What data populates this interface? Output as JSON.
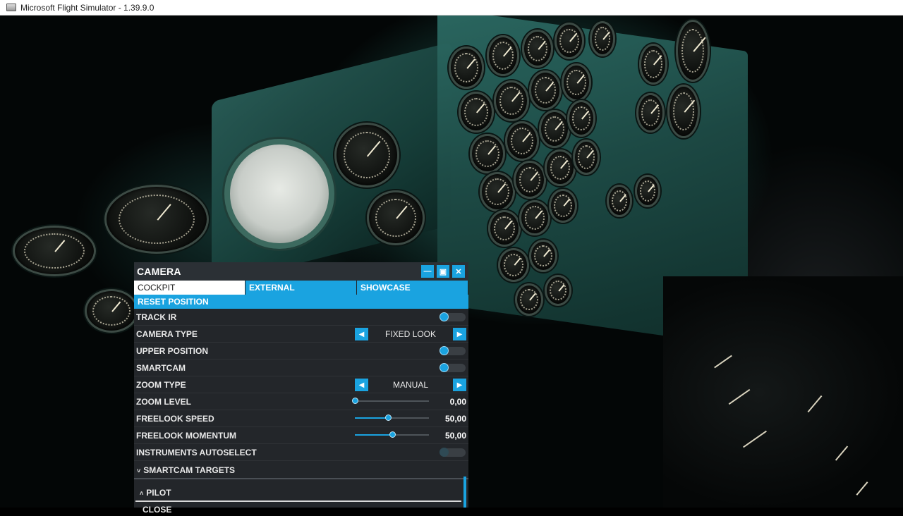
{
  "window": {
    "title": "Microsoft Flight Simulator - 1.39.9.0"
  },
  "camera_panel": {
    "title": "CAMERA",
    "header_buttons": [
      "minimize",
      "undock",
      "close"
    ],
    "tabs": [
      {
        "label": "COCKPIT",
        "active": true
      },
      {
        "label": "EXTERNAL",
        "active": false
      },
      {
        "label": "SHOWCASE",
        "active": false
      }
    ],
    "reset_label": "RESET POSITION",
    "settings": {
      "track_ir": {
        "label": "TRACK IR",
        "state": "on"
      },
      "camera_type": {
        "label": "CAMERA TYPE",
        "value": "FIXED LOOK"
      },
      "upper_position": {
        "label": "UPPER POSITION",
        "state": "on"
      },
      "smartcam": {
        "label": "SMARTCAM",
        "state": "on"
      },
      "zoom_type": {
        "label": "ZOOM TYPE",
        "value": "MANUAL"
      },
      "zoom_level": {
        "label": "ZOOM LEVEL",
        "value": "0,00",
        "fraction": 0.0
      },
      "freelook_speed": {
        "label": "FREELOOK SPEED",
        "value": "50,00",
        "fraction": 0.45
      },
      "freelook_momentum": {
        "label": "FREELOOK MOMENTUM",
        "value": "50,00",
        "fraction": 0.5
      },
      "instruments_autoselect": {
        "label": "INSTRUMENTS AUTOSELECT",
        "state": "off"
      }
    },
    "smartcam_targets": {
      "label": "SMARTCAM TARGETS",
      "pilot_label": "PILOT",
      "close_label": "CLOSE"
    }
  },
  "colors": {
    "accent": "#1aa3e0",
    "panel_bg": "#24282c",
    "title_bar_bg": "#ffffff"
  }
}
